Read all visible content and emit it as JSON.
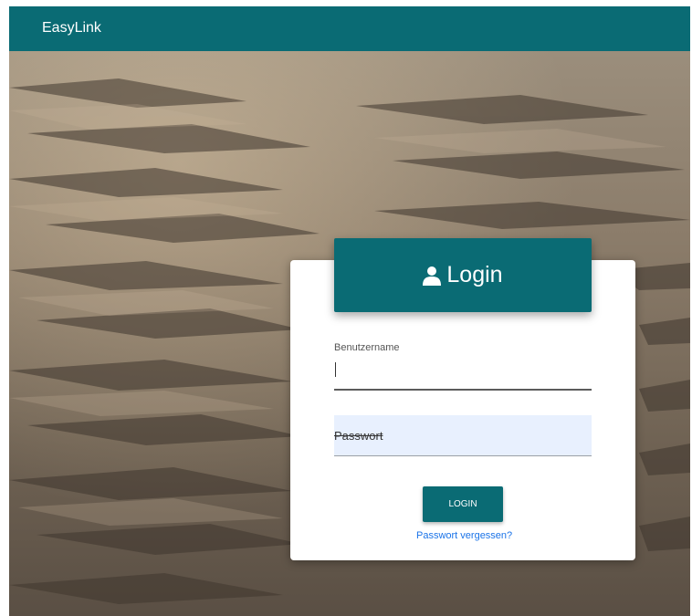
{
  "app": {
    "brand": "EasyLink"
  },
  "login": {
    "header_title": "Login",
    "username_label": "Benutzername",
    "username_value": "",
    "password_placeholder": "Passwort",
    "button_label": "LOGIN",
    "forgot_link": "Passwort vergessen?"
  },
  "icons": {
    "header_icon": "user-icon"
  },
  "colors": {
    "primary": "#0a6b74",
    "link": "#1a73e8",
    "autofill_bg": "#e8f0fe"
  }
}
